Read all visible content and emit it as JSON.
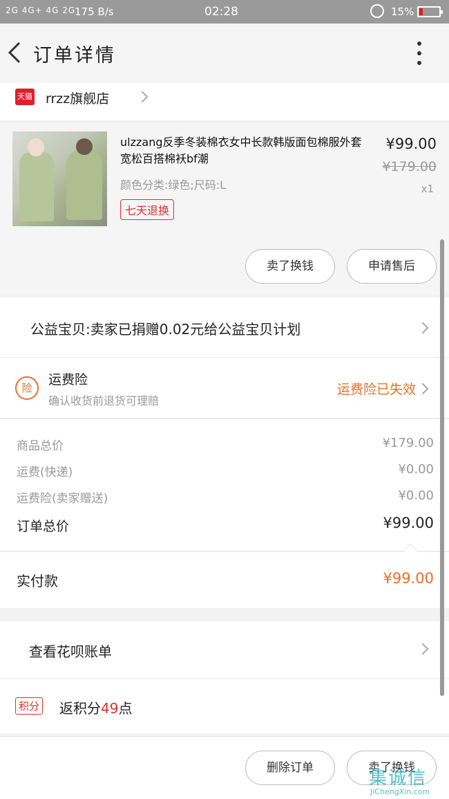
{
  "status_bar": {
    "signal": "2G 4G+ 4G 2G",
    "speed": "175 B/s",
    "time": "02:28",
    "battery": "15%",
    "battery_level": 0.15
  },
  "nav": {
    "title": "订单详情"
  },
  "store": {
    "badge": "天猫",
    "name": "rrzz旗舰店"
  },
  "product": {
    "title": "ulzzang反季冬装棉衣女中长款韩版面包棉服外套宽松百搭棉袄bf潮",
    "spec": "颜色分类:绿色;尺码:L",
    "tag": "七天退换",
    "price": "¥99.00",
    "original_price": "¥179.00",
    "quantity": "x1",
    "buttons": {
      "swap": "卖了换钱",
      "after_sale": "申请售后"
    }
  },
  "charity": {
    "text": "公益宝贝:卖家已捐赠0.02元给公益宝贝计划"
  },
  "insurance": {
    "badge": "险",
    "title": "运费险",
    "subtitle": "确认收货前退货可理赔",
    "status": "运费险已失效"
  },
  "summary": {
    "rows": [
      {
        "label": "商品总价",
        "value": "¥179.00"
      },
      {
        "label": "运费(快递)",
        "value": "¥0.00"
      },
      {
        "label": "运费险(卖家赠送)",
        "value": "¥0.00"
      }
    ],
    "total_label": "订单总价",
    "total_value": "¥99.00"
  },
  "paid": {
    "label": "实付款",
    "value": "¥99.00"
  },
  "huabei": {
    "text": "查看花呗账单"
  },
  "points": {
    "badge": "积分",
    "prefix": "返积分",
    "number": "49",
    "suffix": "点"
  },
  "bottom": {
    "delete": "删除订单",
    "swap": "卖了换钱"
  },
  "watermark": {
    "brand": "集诚信",
    "site": "JiChengXin.com"
  },
  "colors": {
    "accent_orange": "#e8702a",
    "accent_red": "#e0302a",
    "tmall_red": "#e21e2d"
  }
}
